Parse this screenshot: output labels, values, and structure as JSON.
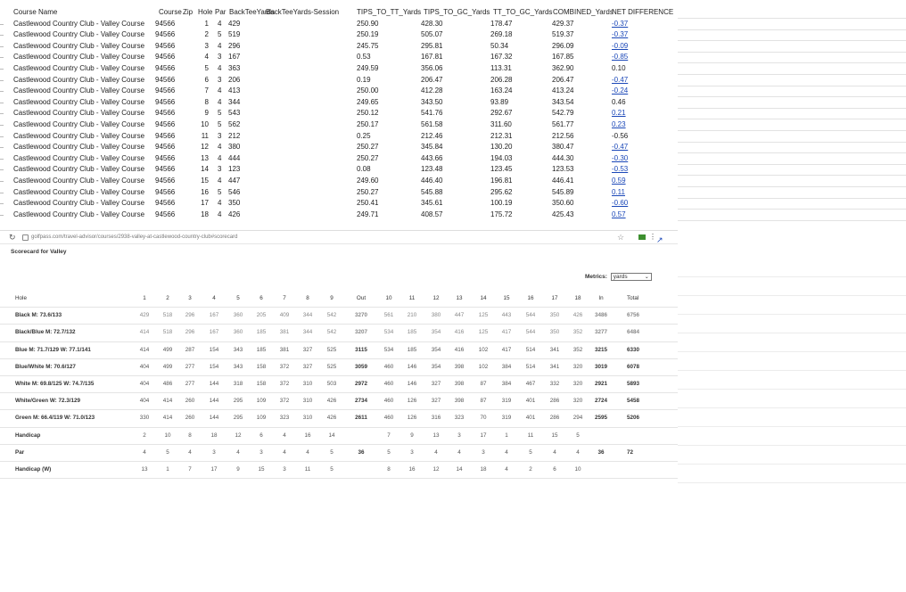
{
  "sheet": {
    "headers": [
      "Course Name",
      "Course",
      "Zip",
      "Hole",
      "Par",
      "BackTeeYards",
      "BackTeeYards-Session",
      "TIPS_TO_TT_Yards",
      "TIPS_TO_GC_Yards",
      "TT_TO_GC_Yards",
      "COMBINED_Yards",
      "NET DIFFERENCE"
    ],
    "rows": [
      [
        "Castlewood Country Club - Valley Course",
        "94566",
        "1",
        "4",
        "429",
        "250.90",
        "428.30",
        "178.47",
        "429.37",
        "-0.37"
      ],
      [
        "Castlewood Country Club - Valley Course",
        "94566",
        "2",
        "5",
        "519",
        "250.19",
        "505.07",
        "269.18",
        "519.37",
        "-0.37"
      ],
      [
        "Castlewood Country Club - Valley Course",
        "94566",
        "3",
        "4",
        "296",
        "245.75",
        "295.81",
        "50.34",
        "296.09",
        "-0.09"
      ],
      [
        "Castlewood Country Club - Valley Course",
        "94566",
        "4",
        "3",
        "167",
        "0.53",
        "167.81",
        "167.32",
        "167.85",
        "-0.85"
      ],
      [
        "Castlewood Country Club - Valley Course",
        "94566",
        "5",
        "4",
        "363",
        "249.59",
        "356.06",
        "113.31",
        "362.90",
        "0.10"
      ],
      [
        "Castlewood Country Club - Valley Course",
        "94566",
        "6",
        "3",
        "206",
        "0.19",
        "206.47",
        "206.28",
        "206.47",
        "-0.47"
      ],
      [
        "Castlewood Country Club - Valley Course",
        "94566",
        "7",
        "4",
        "413",
        "250.00",
        "412.28",
        "163.24",
        "413.24",
        "-0.24"
      ],
      [
        "Castlewood Country Club - Valley Course",
        "94566",
        "8",
        "4",
        "344",
        "249.65",
        "343.50",
        "93.89",
        "343.54",
        "0.46"
      ],
      [
        "Castlewood Country Club - Valley Course",
        "94566",
        "9",
        "5",
        "543",
        "250.12",
        "541.76",
        "292.67",
        "542.79",
        "0.21"
      ],
      [
        "Castlewood Country Club - Valley Course",
        "94566",
        "10",
        "5",
        "562",
        "250.17",
        "561.58",
        "311.60",
        "561.77",
        "0.23"
      ],
      [
        "Castlewood Country Club - Valley Course",
        "94566",
        "11",
        "3",
        "212",
        "0.25",
        "212.46",
        "212.31",
        "212.56",
        "-0.56"
      ],
      [
        "Castlewood Country Club - Valley Course",
        "94566",
        "12",
        "4",
        "380",
        "250.27",
        "345.84",
        "130.20",
        "380.47",
        "-0.47"
      ],
      [
        "Castlewood Country Club - Valley Course",
        "94566",
        "13",
        "4",
        "444",
        "250.27",
        "443.66",
        "194.03",
        "444.30",
        "-0.30"
      ],
      [
        "Castlewood Country Club - Valley Course",
        "94566",
        "14",
        "3",
        "123",
        "0.08",
        "123.48",
        "123.45",
        "123.53",
        "-0.53"
      ],
      [
        "Castlewood Country Club - Valley Course",
        "94566",
        "15",
        "4",
        "447",
        "249.60",
        "446.40",
        "196.81",
        "446.41",
        "0.59"
      ],
      [
        "Castlewood Country Club - Valley Course",
        "94566",
        "16",
        "5",
        "546",
        "250.27",
        "545.88",
        "295.62",
        "545.89",
        "0.11"
      ],
      [
        "Castlewood Country Club - Valley Course",
        "94566",
        "17",
        "4",
        "350",
        "250.41",
        "345.61",
        "100.19",
        "350.60",
        "-0.60"
      ],
      [
        "Castlewood Country Club - Valley Course",
        "94566",
        "18",
        "4",
        "426",
        "249.71",
        "408.57",
        "175.72",
        "425.43",
        "0.57"
      ]
    ],
    "linked_rows": [
      0,
      1,
      2,
      3,
      5,
      6,
      8,
      9,
      11,
      12,
      13,
      14,
      15,
      16,
      17
    ]
  },
  "browser": {
    "url": "golfpass.com/travel-advisor/courses/2938-valley-at-castlewood-country-club#scorecard",
    "reload_icon": "reload-icon",
    "star_icon": "star-icon"
  },
  "scorecard": {
    "title": "Scorecard for Valley",
    "metrics_label": "Metrics:",
    "metrics_value": "yards",
    "columns": [
      "Hole",
      "1",
      "2",
      "3",
      "4",
      "5",
      "6",
      "7",
      "8",
      "9",
      "Out",
      "10",
      "11",
      "12",
      "13",
      "14",
      "15",
      "16",
      "17",
      "18",
      "In",
      "Total"
    ],
    "rows": [
      {
        "label": "Black M: 73.6/133",
        "values": [
          "429",
          "518",
          "296",
          "167",
          "360",
          "205",
          "409",
          "344",
          "542",
          "3270",
          "561",
          "210",
          "380",
          "447",
          "125",
          "443",
          "544",
          "350",
          "426",
          "3486",
          "6756"
        ],
        "faint": true
      },
      {
        "label": "Black/Blue M: 72.7/132",
        "values": [
          "414",
          "518",
          "296",
          "167",
          "360",
          "185",
          "381",
          "344",
          "542",
          "3207",
          "534",
          "185",
          "354",
          "416",
          "125",
          "417",
          "544",
          "350",
          "352",
          "3277",
          "6484"
        ],
        "faint": true
      },
      {
        "label": "Blue M: 71.7/129 W: 77.1/141",
        "values": [
          "414",
          "499",
          "287",
          "154",
          "343",
          "185",
          "381",
          "327",
          "525",
          "3115",
          "534",
          "185",
          "354",
          "416",
          "102",
          "417",
          "514",
          "341",
          "352",
          "3215",
          "6330"
        ]
      },
      {
        "label": "Blue/White M: 70.6/127",
        "values": [
          "404",
          "499",
          "277",
          "154",
          "343",
          "158",
          "372",
          "327",
          "525",
          "3059",
          "460",
          "146",
          "354",
          "398",
          "102",
          "384",
          "514",
          "341",
          "320",
          "3019",
          "6078"
        ]
      },
      {
        "label": "White M: 69.8/125 W: 74.7/135",
        "values": [
          "404",
          "486",
          "277",
          "144",
          "318",
          "158",
          "372",
          "310",
          "503",
          "2972",
          "460",
          "146",
          "327",
          "398",
          "87",
          "384",
          "467",
          "332",
          "320",
          "2921",
          "5893"
        ]
      },
      {
        "label": "White/Green W: 72.3/129",
        "values": [
          "404",
          "414",
          "260",
          "144",
          "295",
          "109",
          "372",
          "310",
          "426",
          "2734",
          "460",
          "126",
          "327",
          "398",
          "87",
          "319",
          "401",
          "286",
          "320",
          "2724",
          "5458"
        ]
      },
      {
        "label": "Green M: 66.4/119 W: 71.0/123",
        "values": [
          "330",
          "414",
          "260",
          "144",
          "295",
          "109",
          "323",
          "310",
          "426",
          "2611",
          "460",
          "126",
          "316",
          "323",
          "70",
          "319",
          "401",
          "286",
          "294",
          "2595",
          "5206"
        ]
      },
      {
        "label": "Handicap",
        "values": [
          "2",
          "10",
          "8",
          "18",
          "12",
          "6",
          "4",
          "16",
          "14",
          "",
          "7",
          "9",
          "13",
          "3",
          "17",
          "1",
          "11",
          "15",
          "5",
          "",
          ""
        ]
      },
      {
        "label": "Par",
        "values": [
          "4",
          "5",
          "4",
          "3",
          "4",
          "3",
          "4",
          "4",
          "5",
          "36",
          "5",
          "3",
          "4",
          "4",
          "3",
          "4",
          "5",
          "4",
          "4",
          "36",
          "72"
        ]
      },
      {
        "label": "Handicap (W)",
        "values": [
          "13",
          "1",
          "7",
          "17",
          "9",
          "15",
          "3",
          "11",
          "5",
          "",
          "8",
          "16",
          "12",
          "14",
          "18",
          "4",
          "2",
          "6",
          "10",
          "",
          ""
        ]
      }
    ]
  }
}
